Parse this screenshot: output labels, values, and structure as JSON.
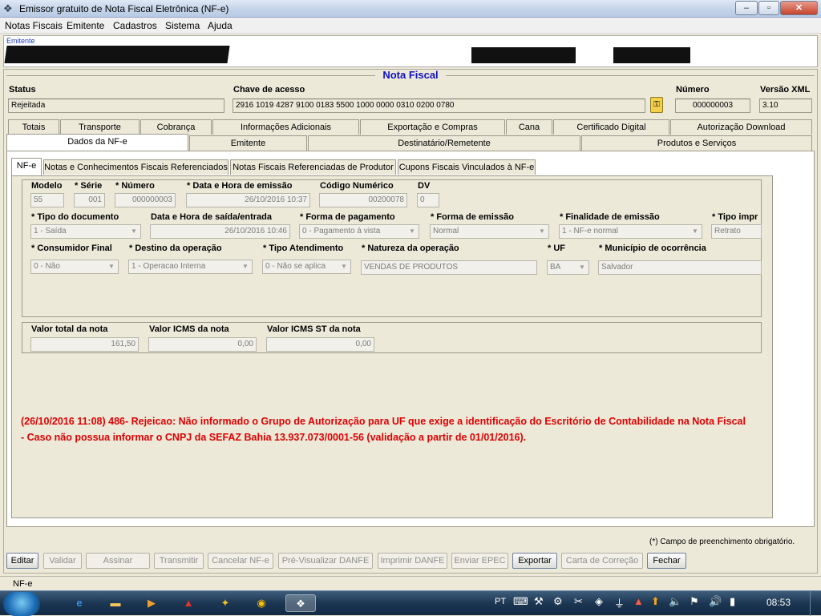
{
  "window": {
    "title": "Emissor gratuito de Nota Fiscal Eletrônica (NF-e)",
    "minimize": "–",
    "maximize": "▫",
    "close": "✕"
  },
  "menu": [
    "Notas Fiscais",
    "Emitente",
    "Cadastros",
    "Sistema",
    "Ajuda"
  ],
  "emitente": {
    "label": "Emitente"
  },
  "panel_title": "Nota Fiscal",
  "header": {
    "status_label": "Status",
    "status_value": "Rejeitada",
    "chave_label": "Chave de acesso",
    "chave_value": "2916 1019 4287 9100 0183 5500 1000 0000 0310 0200 0780",
    "numero_label": "Número",
    "numero_value": "000000003",
    "versao_label": "Versão XML",
    "versao_value": "3.10"
  },
  "tabs_row1": [
    "Totais",
    "Transporte",
    "Cobrança",
    "Informações Adicionais",
    "Exportação e Compras",
    "Cana",
    "Certificado Digital",
    "Autorização Download"
  ],
  "tabs_row2": [
    "Dados da NF-e",
    "Emitente",
    "Destinatário/Remetente",
    "Produtos e Serviços"
  ],
  "subtabs": [
    "NF-e",
    "Notas e Conhecimentos Fiscais Referenciados",
    "Notas Fiscais Referenciadas de Produtor",
    "Cupons Fiscais Vinculados à NF-e"
  ],
  "form": {
    "modelo_label": "Modelo",
    "modelo": "55",
    "serie_label": "* Série",
    "serie": "001",
    "numero_label": "* Número",
    "numero": "000000003",
    "data_emissao_label": "* Data e Hora de emissão",
    "data_emissao": "26/10/2016 10:37",
    "codigo_label": "Código Numérico",
    "codigo": "00200078",
    "dv_label": "DV",
    "dv": "0",
    "tipo_doc_label": "* Tipo do documento",
    "tipo_doc": "1 - Saída",
    "data_saida_label": "Data e Hora de saída/entrada",
    "data_saida": "26/10/2016 10:46",
    "forma_pag_label": "* Forma de pagamento",
    "forma_pag": "0 - Pagamento à vista",
    "forma_emissao_label": "* Forma de emissão",
    "forma_emissao": "Normal",
    "finalidade_label": "* Finalidade de emissão",
    "finalidade": "1 - NF-e normal",
    "tipo_impr_label": "* Tipo impr",
    "tipo_impr": "Retrato",
    "consumidor_label": "* Consumidor Final",
    "consumidor": "0 - Não",
    "destino_label": "* Destino da operação",
    "destino": "1 - Operacao Interna",
    "atendimento_label": "* Tipo Atendimento",
    "atendimento": "0 - Não se aplica",
    "natureza_label": "* Natureza da operação",
    "natureza": "VENDAS DE PRODUTOS",
    "uf_label": "* UF",
    "uf": "BA",
    "municipio_label": "* Município de ocorrência",
    "municipio": "Salvador"
  },
  "totais": {
    "vtotal_label": "Valor total da nota",
    "vtotal": "161,50",
    "icms_label": "Valor ICMS da nota",
    "icms": "0,00",
    "icmsst_label": "Valor ICMS ST da nota",
    "icmsst": "0,00"
  },
  "error_message": "(26/10/2016 11:08) 486- Rejeicao: Não informado o Grupo de Autorização para UF que exige a identificação do Escritório de Contabilidade na Nota Fiscal - Caso não possua informar o CNPJ da SEFAZ Bahia 13.937.073/0001-56 (validação a partir de 01/01/2016).",
  "required_note": "(*) Campo de preenchimento obrigatório.",
  "buttons": [
    "Editar",
    "Validar",
    "Assinar",
    "Transmitir",
    "Cancelar NF-e",
    "Pré-Visualizar DANFE",
    "Imprimir DANFE",
    "Enviar EPEC",
    "Exportar",
    "Carta de Correção",
    "Fechar"
  ],
  "statusbar": "NF-e",
  "taskbar": {
    "lang": "PT",
    "clock": "08:53"
  }
}
